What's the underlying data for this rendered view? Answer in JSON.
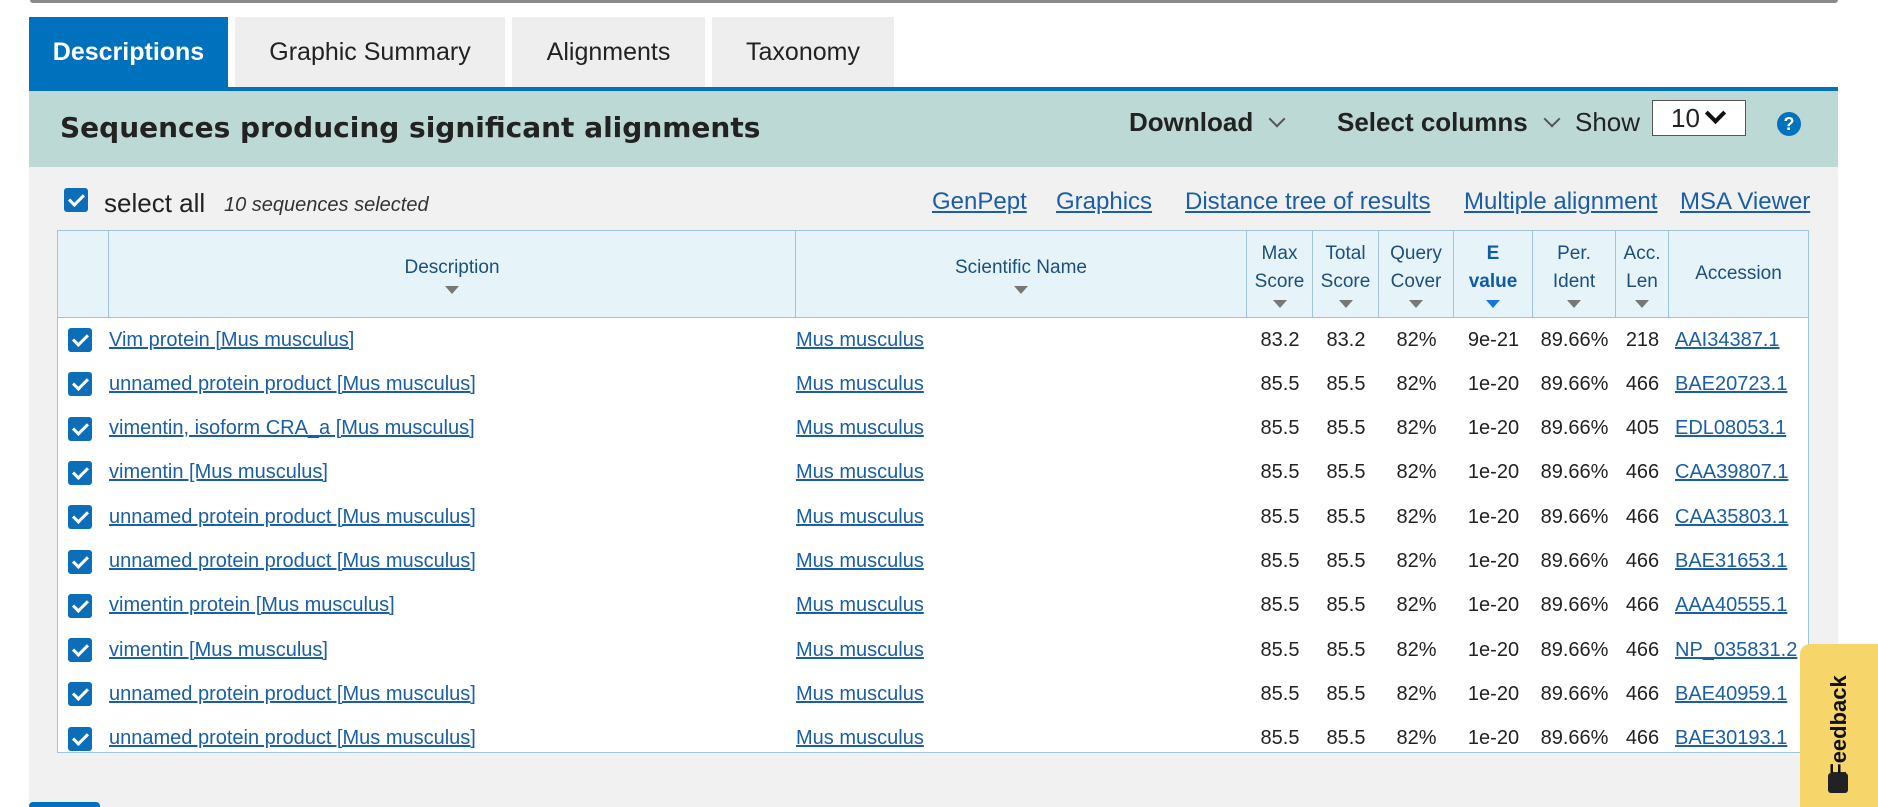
{
  "tabs": [
    {
      "label": "Descriptions",
      "active": true
    },
    {
      "label": "Graphic Summary",
      "active": false
    },
    {
      "label": "Alignments",
      "active": false
    },
    {
      "label": "Taxonomy",
      "active": false
    }
  ],
  "header": {
    "title": "Sequences producing significant alignments",
    "download_label": "Download",
    "select_columns_label": "Select columns",
    "show_label": "Show",
    "show_value": "10",
    "help_glyph": "?"
  },
  "selection": {
    "select_all_label": "select all",
    "selected_count_text": "10 sequences selected"
  },
  "links": {
    "genpept": "GenPept",
    "graphics": "Graphics",
    "distance_tree": "Distance tree of results",
    "multiple_alignment": "Multiple alignment",
    "msa_viewer": "MSA Viewer"
  },
  "columns": {
    "description": "Description",
    "scientific_name": "Scientific Name",
    "max_score_1": "Max",
    "max_score_2": "Score",
    "total_score_1": "Total",
    "total_score_2": "Score",
    "query_cover_1": "Query",
    "query_cover_2": "Cover",
    "e_value_1": "E",
    "e_value_2": "value",
    "per_ident_1": "Per.",
    "per_ident_2": "Ident",
    "acc_len_1": "Acc.",
    "acc_len_2": "Len",
    "accession": "Accession"
  },
  "rows": [
    {
      "description": "Vim protein [Mus musculus]",
      "scientific_name": "Mus musculus",
      "max_score": "83.2",
      "total_score": "83.2",
      "query_cover": "82%",
      "e_value": "9e-21",
      "per_ident": "89.66%",
      "acc_len": "218",
      "accession": "AAI34387.1"
    },
    {
      "description": "unnamed protein product [Mus musculus]",
      "scientific_name": "Mus musculus",
      "max_score": "85.5",
      "total_score": "85.5",
      "query_cover": "82%",
      "e_value": "1e-20",
      "per_ident": "89.66%",
      "acc_len": "466",
      "accession": "BAE20723.1"
    },
    {
      "description": "vimentin, isoform CRA_a [Mus musculus]",
      "scientific_name": "Mus musculus",
      "max_score": "85.5",
      "total_score": "85.5",
      "query_cover": "82%",
      "e_value": "1e-20",
      "per_ident": "89.66%",
      "acc_len": "405",
      "accession": "EDL08053.1"
    },
    {
      "description": "vimentin [Mus musculus]",
      "scientific_name": "Mus musculus",
      "max_score": "85.5",
      "total_score": "85.5",
      "query_cover": "82%",
      "e_value": "1e-20",
      "per_ident": "89.66%",
      "acc_len": "466",
      "accession": "CAA39807.1"
    },
    {
      "description": "unnamed protein product [Mus musculus]",
      "scientific_name": "Mus musculus",
      "max_score": "85.5",
      "total_score": "85.5",
      "query_cover": "82%",
      "e_value": "1e-20",
      "per_ident": "89.66%",
      "acc_len": "466",
      "accession": "CAA35803.1"
    },
    {
      "description": "unnamed protein product [Mus musculus]",
      "scientific_name": "Mus musculus",
      "max_score": "85.5",
      "total_score": "85.5",
      "query_cover": "82%",
      "e_value": "1e-20",
      "per_ident": "89.66%",
      "acc_len": "466",
      "accession": "BAE31653.1"
    },
    {
      "description": "vimentin protein [Mus musculus]",
      "scientific_name": "Mus musculus",
      "max_score": "85.5",
      "total_score": "85.5",
      "query_cover": "82%",
      "e_value": "1e-20",
      "per_ident": "89.66%",
      "acc_len": "466",
      "accession": "AAA40555.1"
    },
    {
      "description": "vimentin [Mus musculus]",
      "scientific_name": "Mus musculus",
      "max_score": "85.5",
      "total_score": "85.5",
      "query_cover": "82%",
      "e_value": "1e-20",
      "per_ident": "89.66%",
      "acc_len": "466",
      "accession": "NP_035831.2"
    },
    {
      "description": "unnamed protein product [Mus musculus]",
      "scientific_name": "Mus musculus",
      "max_score": "85.5",
      "total_score": "85.5",
      "query_cover": "82%",
      "e_value": "1e-20",
      "per_ident": "89.66%",
      "acc_len": "466",
      "accession": "BAE40959.1"
    },
    {
      "description": "unnamed protein product [Mus musculus]",
      "scientific_name": "Mus musculus",
      "max_score": "85.5",
      "total_score": "85.5",
      "query_cover": "82%",
      "e_value": "1e-20",
      "per_ident": "89.66%",
      "acc_len": "466",
      "accession": "BAE30193.1"
    }
  ],
  "feedback": {
    "label": "Feedback"
  },
  "colors": {
    "accent": "#0071bc",
    "header_band": "#bcd9d6",
    "link": "#1a5ea7",
    "feedback": "#f6d56a"
  }
}
